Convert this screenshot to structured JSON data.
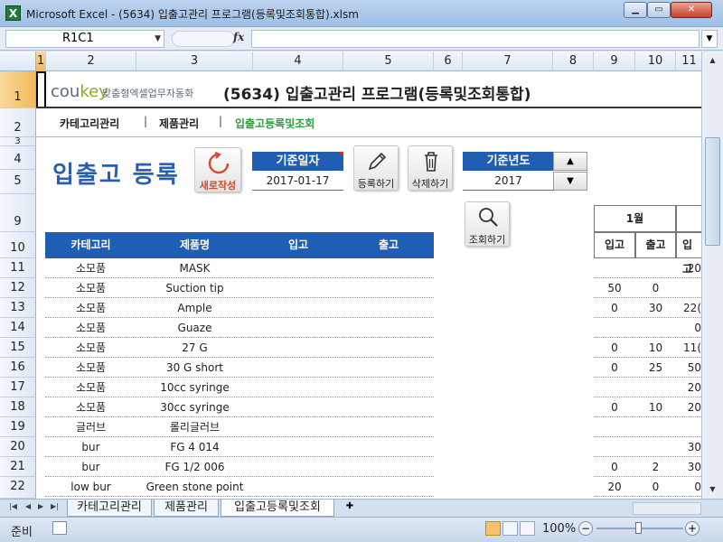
{
  "window": {
    "app_icon": "X",
    "title": "Microsoft Excel - (5634) 입출고관리 프로그램(등록및조회통합).xlsm"
  },
  "formula_bar": {
    "name_box": "R1C1",
    "fx_label": "fx",
    "formula": ""
  },
  "columns": [
    "1",
    "2",
    "3",
    "4",
    "5",
    "6",
    "7",
    "8",
    "9",
    "10",
    "11"
  ],
  "rows": [
    "1",
    "2",
    "3",
    "4",
    "5",
    "9",
    "10",
    "11",
    "12",
    "13",
    "14",
    "15",
    "16",
    "17",
    "18",
    "19",
    "20",
    "21",
    "22"
  ],
  "header": {
    "logo_main": "cou",
    "logo_accent": "key",
    "logo_tagline": "맞춤형엑셀업무자동화",
    "title": "(5634) 입출고관리 프로그램(등록및조회통합)"
  },
  "nav": {
    "items": [
      "카테고리관리",
      "제품관리",
      "입출고등록및조회"
    ],
    "separator": "|"
  },
  "form": {
    "page_title": "입출고 등록",
    "refresh_label": "새로작성",
    "base_date_label": "기준일자",
    "base_date_value": "2017-01-17",
    "register_label": "등록하기",
    "delete_label": "삭제하기",
    "base_year_label": "기준년도",
    "base_year_value": "2017",
    "search_label": "조회하기"
  },
  "table": {
    "headers": [
      "카테고리",
      "제품명",
      "입고",
      "출고"
    ],
    "month_header": "1월",
    "month_sub": [
      "입고",
      "출고",
      "입고"
    ],
    "rows": [
      {
        "cat": "소모품",
        "name": "MASK",
        "m_in": "",
        "m_out": "",
        "m2": "20"
      },
      {
        "cat": "소모품",
        "name": "Suction tip",
        "m_in": "50",
        "m_out": "0",
        "m2": ""
      },
      {
        "cat": "소모품",
        "name": "Ample",
        "m_in": "0",
        "m_out": "30",
        "m2": "22("
      },
      {
        "cat": "소모품",
        "name": "Guaze",
        "m_in": "",
        "m_out": "",
        "m2": "0"
      },
      {
        "cat": "소모품",
        "name": "27 G",
        "m_in": "0",
        "m_out": "10",
        "m2": "11("
      },
      {
        "cat": "소모품",
        "name": "30 G short",
        "m_in": "0",
        "m_out": "25",
        "m2": "50"
      },
      {
        "cat": "소모품",
        "name": "10cc syringe",
        "m_in": "",
        "m_out": "",
        "m2": "20"
      },
      {
        "cat": "소모품",
        "name": "30cc syringe",
        "m_in": "0",
        "m_out": "10",
        "m2": "20"
      },
      {
        "cat": "글러브",
        "name": "롤리글러브",
        "m_in": "",
        "m_out": "",
        "m2": ""
      },
      {
        "cat": "bur",
        "name": "FG 4 014",
        "m_in": "",
        "m_out": "",
        "m2": "30"
      },
      {
        "cat": "bur",
        "name": "FG 1/2 006",
        "m_in": "0",
        "m_out": "2",
        "m2": "30"
      },
      {
        "cat": "low bur",
        "name": "Green stone point",
        "m_in": "20",
        "m_out": "0",
        "m2": "0"
      }
    ]
  },
  "sheet_tabs": [
    "카테고리관리",
    "제품관리",
    "입출고등록및조회"
  ],
  "status": {
    "ready": "준비",
    "zoom": "100%",
    "minus": "−",
    "plus": "+"
  },
  "colors": {
    "accent_blue": "#1f5eb3",
    "title_blue": "#2a5fae",
    "active_nav_green": "#2e9b3f",
    "refresh_red": "#d24a2a"
  }
}
